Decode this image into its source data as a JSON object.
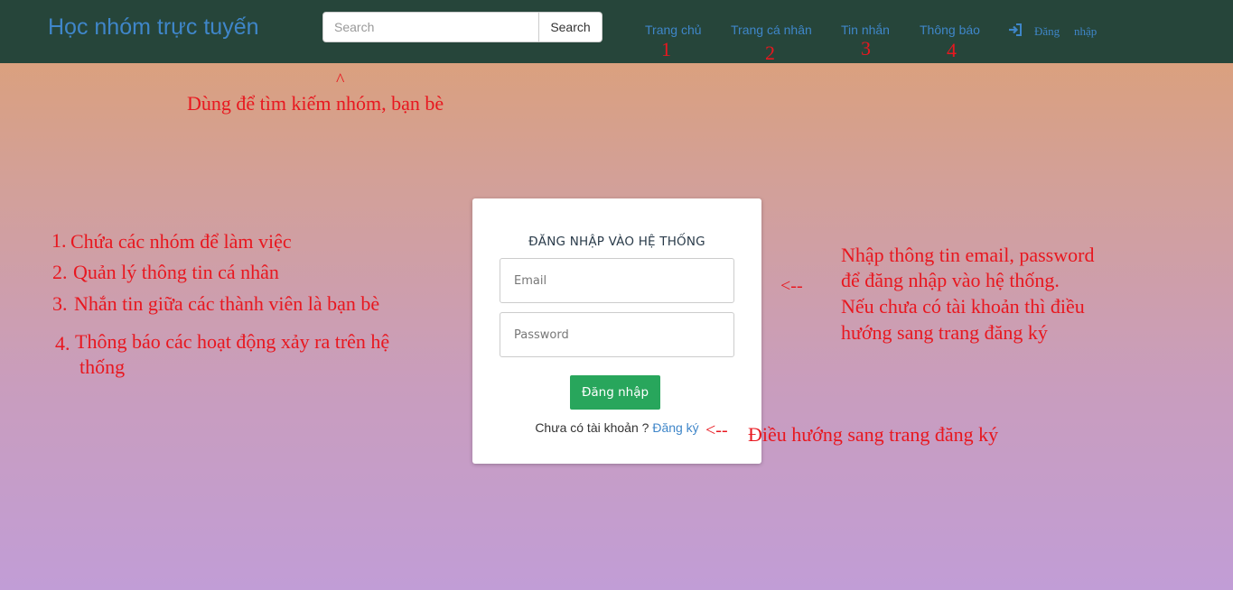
{
  "navbar": {
    "brand": "Học nhóm trực tuyến",
    "search_placeholder": "Search",
    "search_button": "Search",
    "links": [
      "Trang chủ",
      "Trang cá nhân",
      "Tin nhắn",
      "Thông báo"
    ],
    "login_word1": "Đăng",
    "login_word2": "nhập",
    "login_icon": "sign-in-icon"
  },
  "annotations": {
    "nav_numbers": [
      "1",
      "2",
      "3",
      "4"
    ],
    "search_caret": "^",
    "search_note": "Dùng để tìm kiếm nhóm, bạn bè",
    "left_list": [
      {
        "num": "1.",
        "text": "Chứa các nhóm để làm việc"
      },
      {
        "num": "2.",
        "text": "Quản lý thông tin cá nhân"
      },
      {
        "num": "3.",
        "text": "Nhắn tin giữa các thành viên là bạn bè"
      },
      {
        "num": "4.",
        "text": "Thông báo các hoạt động xảy ra trên hệ"
      }
    ],
    "left_list_cont": "thống",
    "form_arrow": "<--",
    "form_note": [
      "Nhập thông tin email, password",
      "để đăng nhập vào hệ thống.",
      "Nếu chưa có tài khoản thì điều",
      "hướng sang trang đăng ký"
    ],
    "register_arrow": "<--",
    "register_note": "Điều hướng sang trang đăng ký"
  },
  "login_form": {
    "title": "ĐĂNG NHẬP VÀO HỆ THỐNG",
    "email_placeholder": "Email",
    "password_placeholder": "Password",
    "submit": "Đăng nhập",
    "no_account": "Chưa có tài khoản ?",
    "register_link": "Đăng ký"
  },
  "colors": {
    "navbar_bg": "#26453a",
    "link": "#3f86c9",
    "annotation_red": "#e8171f",
    "submit_green": "#28a65c"
  }
}
